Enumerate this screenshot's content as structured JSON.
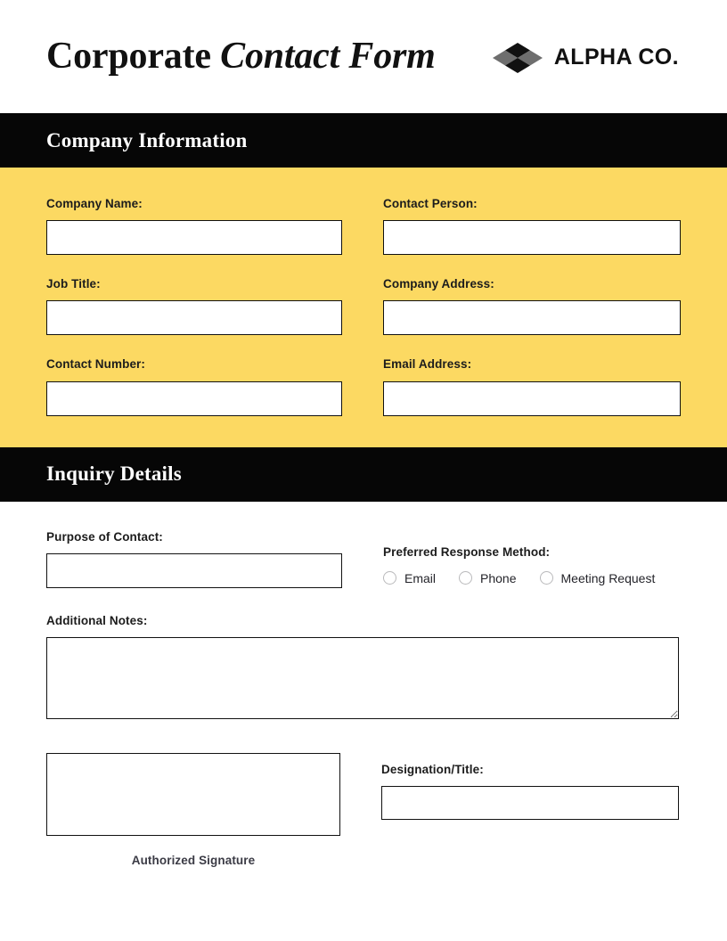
{
  "header": {
    "title_regular": "Corporate",
    "title_italic": "Contact Form",
    "brand_name": "ALPHA CO.",
    "logo_icon": "four-diamond-logo",
    "logo_colors": {
      "dark": "#111111",
      "gray": "#6e6e6e"
    }
  },
  "theme": {
    "accent_yellow": "#FCD962",
    "bar_black": "#060606",
    "text_dark": "#1c1c1c",
    "border_dark": "#111111",
    "radio_ring": "#b9b9bb",
    "page_background": "#ffffff"
  },
  "sections": [
    {
      "id": "company-information",
      "heading": "Company Information",
      "fields": [
        {
          "label": "Company Name:",
          "value": "",
          "placeholder": ""
        },
        {
          "label": "Contact Person:",
          "value": "",
          "placeholder": ""
        },
        {
          "label": "Job Title:",
          "value": "",
          "placeholder": ""
        },
        {
          "label": "Company Address:",
          "value": "",
          "placeholder": ""
        },
        {
          "label": "Contact Number:",
          "value": "",
          "placeholder": ""
        },
        {
          "label": "Email Address:",
          "value": "",
          "placeholder": ""
        }
      ]
    },
    {
      "id": "inquiry-details",
      "heading": "Inquiry Details",
      "purpose": {
        "label": "Purpose of Contact:",
        "value": "",
        "placeholder": ""
      },
      "response_method": {
        "label": "Preferred Response Method:",
        "selected": "",
        "options": [
          {
            "label": "Email",
            "checked": false
          },
          {
            "label": "Phone",
            "checked": false
          },
          {
            "label": "Meeting Request",
            "checked": false
          }
        ]
      },
      "notes": {
        "label": "Additional Notes:",
        "value": "",
        "placeholder": ""
      },
      "signature": {
        "caption": "Authorized Signature",
        "value": ""
      },
      "designation": {
        "label": "Designation/Title:",
        "value": "",
        "placeholder": ""
      }
    }
  ]
}
